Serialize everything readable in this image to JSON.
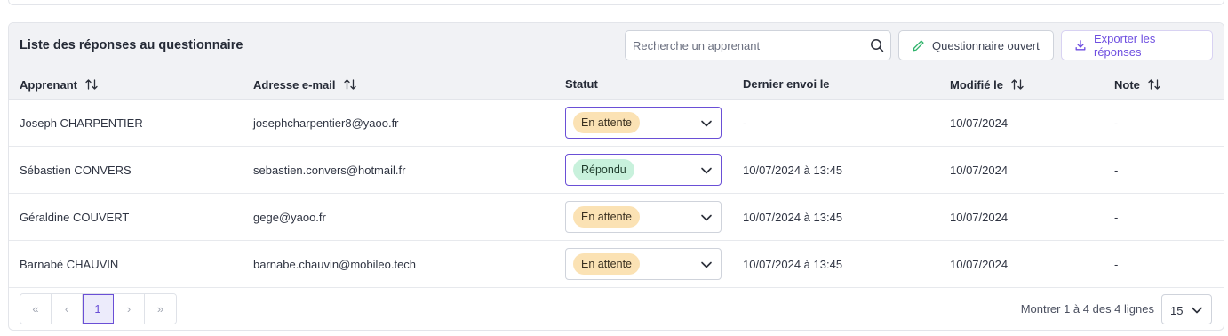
{
  "header": {
    "title": "Liste des réponses au questionnaire",
    "search_placeholder": "Recherche un apprenant",
    "open_button": "Questionnaire ouvert",
    "export_button": "Exporter les réponses"
  },
  "columns": [
    "Apprenant",
    "Adresse e-mail",
    "Statut",
    "Dernier envoi le",
    "Modifié le",
    "Note"
  ],
  "rows": [
    {
      "name": "Joseph CHARPENTIER",
      "email": "josephcharpentier8@yaoo.fr",
      "status": "En attente",
      "last_sent": "-",
      "modified": "10/07/2024",
      "note": "-"
    },
    {
      "name": "Sébastien CONVERS",
      "email": "sebastien.convers@hotmail.fr",
      "status": "Répondu",
      "last_sent": "10/07/2024 à 13:45",
      "modified": "10/07/2024",
      "note": "-"
    },
    {
      "name": "Géraldine COUVERT",
      "email": "gege@yaoo.fr",
      "status": "En attente",
      "last_sent": "10/07/2024 à 13:45",
      "modified": "10/07/2024",
      "note": "-"
    },
    {
      "name": "Barnabé CHAUVIN",
      "email": "barnabe.chauvin@mobileo.tech",
      "status": "En attente",
      "last_sent": "10/07/2024 à 13:45",
      "modified": "10/07/2024",
      "note": "-"
    }
  ],
  "pagination": {
    "first": "«",
    "prev": "‹",
    "current_page": "1",
    "next": "›",
    "last": "»",
    "showing": "Montrer 1 à 4 des 4 lignes",
    "per_page": "15"
  },
  "colors": {
    "accent": "#6a4fd6",
    "pending_badge": "#fbe2b4",
    "answered_badge": "#c8f1dc",
    "open_icon": "#2fb36b"
  },
  "icons": {
    "search": "search-icon",
    "open": "pencil-icon",
    "export": "download-icon",
    "sort": "sort-icon",
    "dropdown": "chevron-down-icon"
  }
}
